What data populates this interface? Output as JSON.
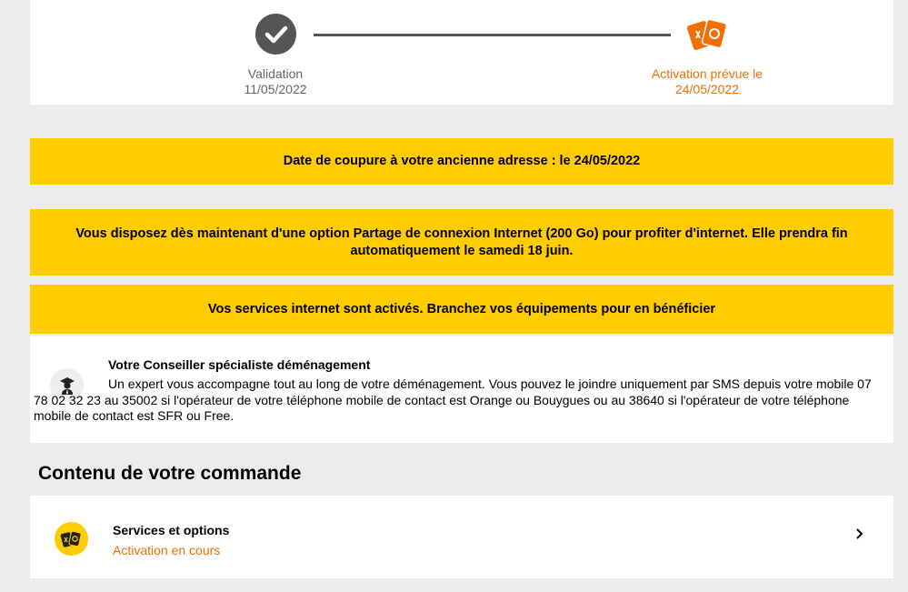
{
  "progress": {
    "step1": {
      "label": "Validation",
      "date": "11/05/2022",
      "icon": "check-circle-icon"
    },
    "step2": {
      "label": "Activation prévue le",
      "date": "24/05/2022",
      "icon": "cards-icon"
    },
    "colors": {
      "done": "#555555",
      "accent": "#f16e00"
    }
  },
  "banners": {
    "cutoff": "Date de coupure à votre ancienne adresse : le 24/05/2022",
    "sharing_line1": "Vous disposez dès maintenant d'une option Partage de connexion Internet (200 Go) pour profiter d'internet. Elle prendra fin",
    "sharing_line2": "automatiquement le samedi 18 juin.",
    "activated": "Vos services internet sont activés. Branchez vos équipements pour en bénéficier",
    "color": "#ffcc00"
  },
  "advisor": {
    "title": "Votre Conseiller spécialiste déménagement",
    "text": "Un expert vous accompagne tout au long de votre déménagement. Vous pouvez le joindre uniquement par SMS depuis votre mobile 07 78 02 32 23 au 35002 si l'opérateur de votre téléphone mobile de contact est Orange ou Bouygues ou au 38640 si l'opérateur de votre téléphone mobile de contact est SFR ou Free.",
    "icon": "advisor-icon"
  },
  "order": {
    "section_title": "Contenu de votre commande",
    "item_title": "Services et options",
    "item_status": "Activation en cours",
    "icon": "cards-icon",
    "chevron": "chevron-right-icon"
  }
}
